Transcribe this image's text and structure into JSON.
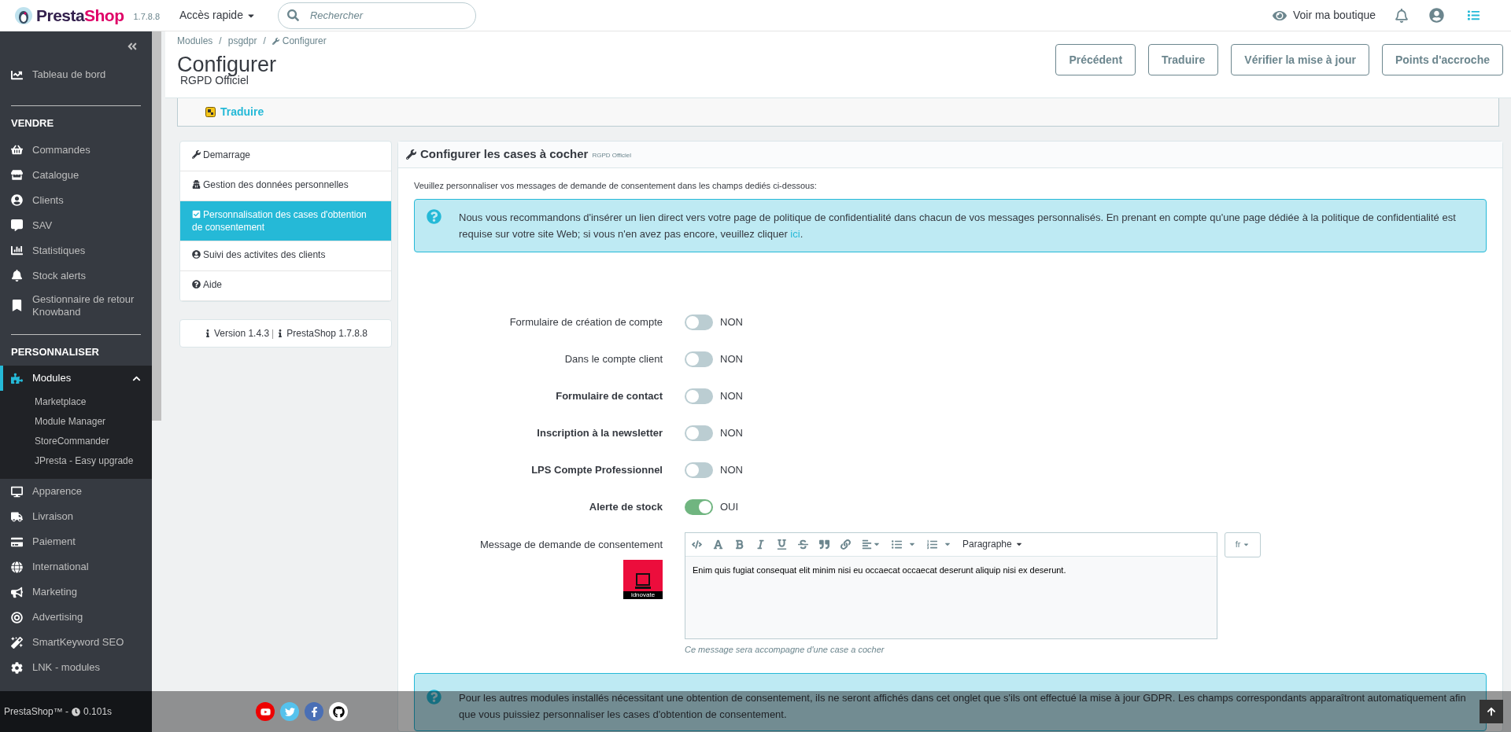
{
  "topbar": {
    "logo": [
      "Presta",
      "Shop"
    ],
    "version": "1.7.8.8",
    "quick_access": "Accès rapide",
    "search": {
      "placeholder": "Rechercher"
    },
    "view_shop": "Voir ma boutique"
  },
  "sidebar": {
    "top_item": {
      "label": "Tableau de bord",
      "selected": false
    },
    "sections": [
      {
        "title": "VENDRE",
        "items": [
          {
            "label": "Commandes",
            "selected": false
          },
          {
            "label": "Catalogue",
            "selected": false
          },
          {
            "label": "Clients",
            "selected": false
          },
          {
            "label": "SAV",
            "selected": false
          },
          {
            "label": "Statistiques",
            "selected": false
          },
          {
            "label": "Stock alerts",
            "selected": false
          },
          {
            "label": "Gestionnaire de retour Knowband",
            "selected": false
          }
        ]
      },
      {
        "title": "PERSONNALISER",
        "items": [
          {
            "label": "Modules",
            "selected": true,
            "expanded": true,
            "children": [
              {
                "label": "Marketplace"
              },
              {
                "label": "Module Manager"
              },
              {
                "label": "StoreCommander"
              },
              {
                "label": "JPresta - Easy upgrade"
              }
            ]
          },
          {
            "label": "Apparence",
            "selected": false
          },
          {
            "label": "Livraison",
            "selected": false
          },
          {
            "label": "Paiement",
            "selected": false
          },
          {
            "label": "International",
            "selected": false
          },
          {
            "label": "Marketing",
            "selected": false
          },
          {
            "label": "Advertising",
            "selected": false
          },
          {
            "label": "SmartKeyword SEO",
            "selected": false
          },
          {
            "label": "LNK - modules",
            "selected": false
          }
        ]
      }
    ]
  },
  "header": {
    "breadcrumb": [
      "Modules",
      "psgdpr",
      "Configurer"
    ],
    "breadcrumb_separators": [
      "/",
      "/"
    ],
    "title": "Configurer",
    "subtitle": "RGPD Officiel",
    "buttons": [
      "Précédent",
      "Traduire",
      "Vérifier la mise à jour",
      "Points d'accroche"
    ],
    "translate_link": "Traduire"
  },
  "module_nav": {
    "items": [
      {
        "label": "Demarrage",
        "selected": false
      },
      {
        "label": "Gestion des données personnelles",
        "selected": false
      },
      {
        "label": "Personnalisation des cases d'obtention de consentement",
        "selected": true
      },
      {
        "label": "Suivi des activites des clients",
        "selected": false
      },
      {
        "label": "Aide",
        "selected": false
      }
    ],
    "version": [
      "Version 1.4.3",
      "|",
      "PrestaShop 1.7.8.8"
    ]
  },
  "panel": {
    "title": "Configurer les cases à cocher",
    "title_note": "RGPD Officiel",
    "intro": "Veuillez personnaliser vos messages de demande de consentement dans les champs dediés ci-dessous:",
    "info": {
      "text": "Nous vous recommandons d'insérer un lien direct vers votre page de politique de confidentialité dans chacun de vos messages personnalisés. En prenant en compte qu'une page dédiée à la politique de confidentialité est requise sur votre site Web; si vous n'en avez pas encore, veuillez cliquer",
      "link": "ici",
      "end": "."
    },
    "toggles": [
      {
        "label": "Formulaire de création de compte",
        "bold": false,
        "on": false,
        "value": "NON"
      },
      {
        "label": "Dans le compte client",
        "bold": false,
        "on": false,
        "value": "NON"
      },
      {
        "label": "Formulaire de contact",
        "bold": true,
        "on": false,
        "value": "NON"
      },
      {
        "label": "Inscription à la newsletter",
        "bold": true,
        "on": false,
        "value": "NON"
      },
      {
        "label": "LPS Compte Professionnel",
        "bold": true,
        "on": false,
        "value": "NON"
      },
      {
        "label": "Alerte de stock",
        "bold": true,
        "on": true,
        "value": "OUI"
      }
    ],
    "message": {
      "label": "Message de demande de consentement",
      "logo_caption": "idnovate",
      "format": "Paragraphe",
      "text": "Enim quis fugiat consequat elit minim nisi eu occaecat occaecat deserunt aliquip nisi ex deserunt.",
      "language": "fr",
      "help": "Ce message sera accompagne d'une case a cocher"
    },
    "info2": "Pour les autres modules installés nécessitant une obtention de consentement, ils ne seront affichés dans cet onglet que s'ils ont effectué la mise à jour GDPR. Les champs correspondants apparaîtront automatiquement afin que vous puissiez personnaliser les cases d'obtention de consentement."
  },
  "footer": {
    "brand": "PrestaShop™ -",
    "time": "0.101s"
  }
}
